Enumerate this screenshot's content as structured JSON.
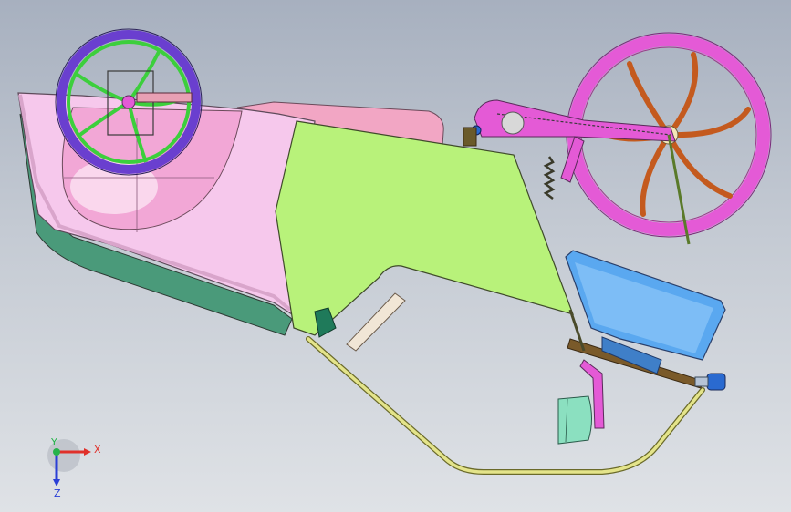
{
  "viewport": {
    "background_top": "#a7b0bf",
    "background_bottom": "#dfe2e6"
  },
  "triad": {
    "x_label": "X",
    "y_label": "Y",
    "z_label": "Z",
    "x_color": "#e0302a",
    "y_color": "#25b34a",
    "z_color": "#2a3fd6"
  },
  "model": {
    "colors": {
      "tub": "#f6c8ec",
      "tub_outline": "#5e4a5a",
      "bowl": "#f2a7d6",
      "side_panel": "#b8f27a",
      "front_wheel_rim": "#6a3fcf",
      "front_wheel_spokes": "#3ccf3c",
      "rear_wheel_rim": "#e45ad6",
      "rear_wheel_spokes": "#c45a1e",
      "swingarm": "#e45ad6",
      "seat": "#5aa8f0",
      "frame_tube": "#d9d96a",
      "skid_plate": "#4a9a7a",
      "cover": "#f2a6c4",
      "pedal": "#f1e6d6",
      "mount": "#7a5a2a",
      "foot_block": "#8be0c0"
    }
  }
}
